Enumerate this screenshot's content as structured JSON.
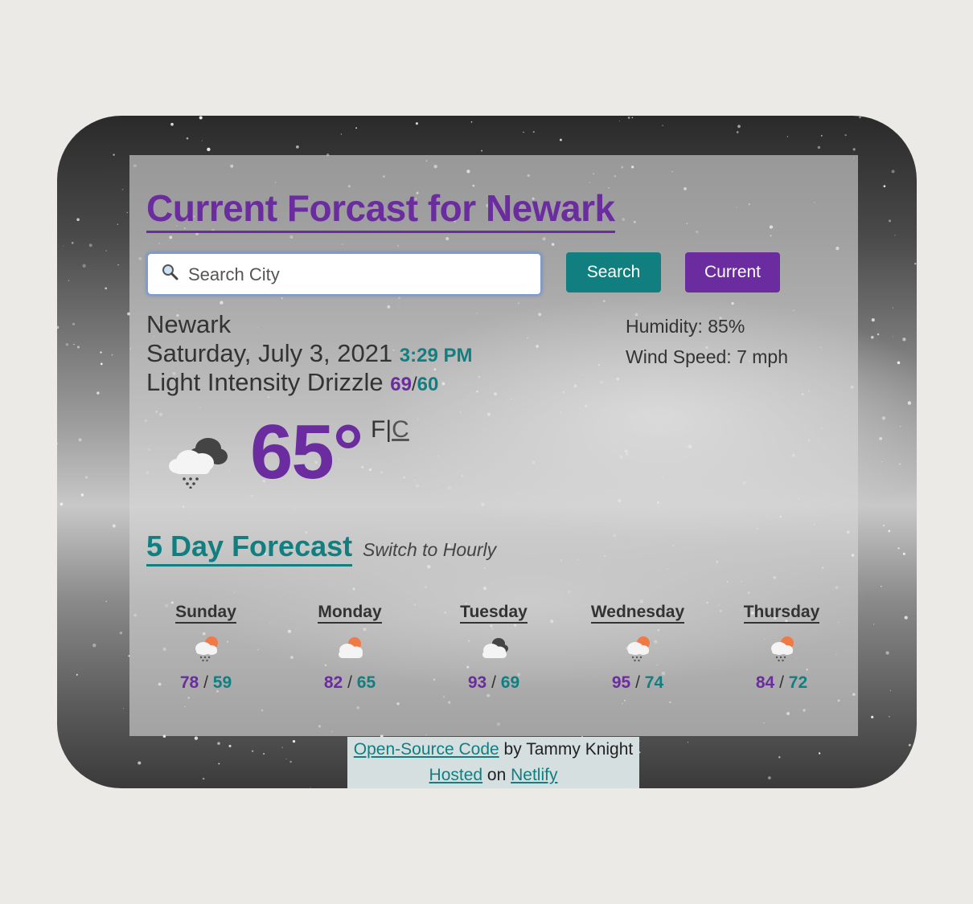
{
  "header": {
    "title": "Current Forcast for Newark"
  },
  "search": {
    "placeholder": "Search City",
    "value": "",
    "search_label": "Search",
    "current_label": "Current"
  },
  "current": {
    "city": "Newark",
    "date": "Saturday, July 3, 2021",
    "time": "3:29 PM",
    "description": "Light Intensity Drizzle",
    "high": "69",
    "low": "60",
    "humidity": "Humidity: 85%",
    "wind": "Wind Speed: 7 mph",
    "temperature": "65°",
    "unit_f": "F",
    "unit_sep": "|",
    "unit_c": "C",
    "icon": "rain-cloud-icon"
  },
  "forecast": {
    "title": "5 Day Forecast",
    "switch_label": "Switch to Hourly",
    "days": [
      {
        "name": "Sunday",
        "high": "78",
        "low": "59",
        "icon": "sun-rain-cloud-icon"
      },
      {
        "name": "Monday",
        "high": "82",
        "low": "65",
        "icon": "sun-cloud-icon"
      },
      {
        "name": "Tuesday",
        "high": "93",
        "low": "69",
        "icon": "dark-cloud-icon"
      },
      {
        "name": "Wednesday",
        "high": "95",
        "low": "74",
        "icon": "sun-rain-cloud-icon"
      },
      {
        "name": "Thursday",
        "high": "84",
        "low": "72",
        "icon": "sun-rain-cloud-icon"
      }
    ]
  },
  "footer": {
    "code_link": "Open-Source Code",
    "by_text": " by Tammy Knight",
    "hosted_link": "Hosted",
    "on_text": " on ",
    "netlify_link": "Netlify"
  },
  "colors": {
    "purple": "#6a2c9e",
    "teal": "#117f80",
    "background": "#ebeae6"
  }
}
